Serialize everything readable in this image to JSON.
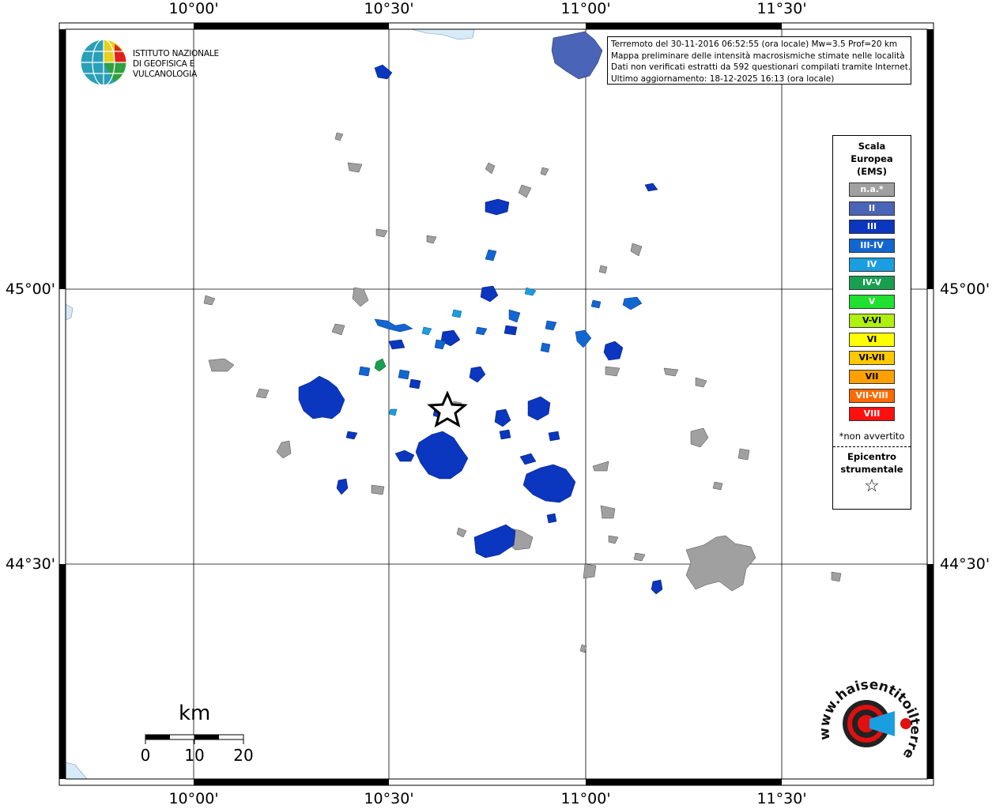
{
  "axis": {
    "lon_labels": [
      "10°00'",
      "10°30'",
      "11°00'",
      "11°30'"
    ],
    "lat_labels": [
      "45°00'",
      "44°30'"
    ]
  },
  "logo": {
    "line1": "ISTITUTO NAZIONALE",
    "line2": "DI GEOFISICA E VULCANOLOGIA"
  },
  "info": {
    "line1": "Terremoto del 30-11-2016 06:52:55 (ora locale) Mw=3.5 Prof=20 km",
    "line2": "Mappa preliminare delle intensità macrosismiche stimate nelle località",
    "line3": "Dati non verificati estratti da 592 questionari compilati tramite Internet.",
    "line4": "Ultimo aggiornamento: 18-12-2025 16:13 (ora locale)"
  },
  "legend": {
    "title": [
      "Scala",
      "Europea",
      "(EMS)"
    ],
    "items": [
      {
        "label": "n.a.*",
        "color": "#a0a0a0"
      },
      {
        "label": "II",
        "color": "#4a64b8"
      },
      {
        "label": "III",
        "color": "#0a36c0"
      },
      {
        "label": "III-IV",
        "color": "#1266d0"
      },
      {
        "label": "IV",
        "color": "#1a9ee0"
      },
      {
        "label": "IV-V",
        "color": "#18a050"
      },
      {
        "label": "V",
        "color": "#20e030"
      },
      {
        "label": "V-VI",
        "color": "#b0f010"
      },
      {
        "label": "VI",
        "color": "#ffff00"
      },
      {
        "label": "VI-VII",
        "color": "#ffc800"
      },
      {
        "label": "VII",
        "color": "#ffa000"
      },
      {
        "label": "VII-VIII",
        "color": "#ff6a00"
      },
      {
        "label": "VIII",
        "color": "#ff1010"
      }
    ],
    "note": "*non avvertito",
    "epicenter_label": [
      "Epicentro",
      "strumentale"
    ],
    "epicenter_icon": "star-outline-icon"
  },
  "scale_bar": {
    "unit": "km",
    "ticks": [
      "0",
      "10",
      "20"
    ]
  },
  "hsit_logo": {
    "text": "www.haisentitoilterremoto.it",
    "icon": "hsit-target-icon",
    "red": "#e01010"
  }
}
